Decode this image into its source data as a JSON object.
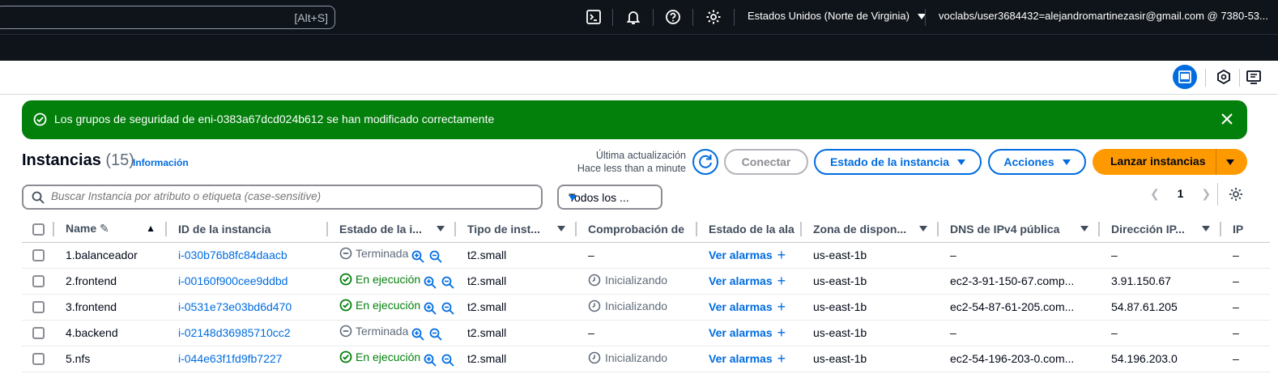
{
  "topbar": {
    "search_shortcut": "[Alt+S]",
    "region": "Estados Unidos (Norte de Virginia)",
    "account": "voclabs/user3684432=alejandromartinezasir@gmail.com @ 7380-53..."
  },
  "flash": {
    "message": "Los grupos de seguridad de eni-0383a67dcd024b612 se han modificado correctamente"
  },
  "header": {
    "title": "Instancias",
    "count": "(15)",
    "info": "Información",
    "last_update_label": "Última actualización",
    "last_update_value": "Hace less than a minute",
    "connect": "Conectar",
    "instance_state": "Estado de la instancia",
    "actions": "Acciones",
    "launch": "Lanzar instancias"
  },
  "filter": {
    "placeholder": "Buscar Instancia por atributo o etiqueta (case-sensitive)",
    "select_value": "Todos los ...",
    "page": "1"
  },
  "columns": [
    "Name",
    "ID de la instancia",
    "Estado de la i...",
    "Tipo de inst...",
    "Comprobación de",
    "Estado de la ala",
    "Zona de dispon...",
    "DNS de IPv4 pública",
    "Dirección IP...",
    "IP"
  ],
  "rows": [
    {
      "name": "1.balanceador",
      "id": "i-030b76b8fc84daacb",
      "state": "Terminada",
      "state_kind": "terminated",
      "type": "t2.small",
      "check": "–",
      "check_kind": "none",
      "alarm": "Ver alarmas",
      "zone": "us-east-1b",
      "dns": "–",
      "ip": "–",
      "ip2": "–"
    },
    {
      "name": "2.frontend",
      "id": "i-00160f900cee9ddbd",
      "state": "En ejecución",
      "state_kind": "running",
      "type": "t2.small",
      "check": "Inicializando",
      "check_kind": "init",
      "alarm": "Ver alarmas",
      "zone": "us-east-1b",
      "dns": "ec2-3-91-150-67.comp...",
      "ip": "3.91.150.67",
      "ip2": "–"
    },
    {
      "name": "3.frontend",
      "id": "i-0531e73e03bd6d470",
      "state": "En ejecución",
      "state_kind": "running",
      "type": "t2.small",
      "check": "Inicializando",
      "check_kind": "init",
      "alarm": "Ver alarmas",
      "zone": "us-east-1b",
      "dns": "ec2-54-87-61-205.com...",
      "ip": "54.87.61.205",
      "ip2": "–"
    },
    {
      "name": "4.backend",
      "id": "i-02148d36985710cc2",
      "state": "Terminada",
      "state_kind": "terminated",
      "type": "t2.small",
      "check": "–",
      "check_kind": "none",
      "alarm": "Ver alarmas",
      "zone": "us-east-1b",
      "dns": "–",
      "ip": "–",
      "ip2": "–"
    },
    {
      "name": "5.nfs",
      "id": "i-044e63f1fd9fb7227",
      "state": "En ejecución",
      "state_kind": "running",
      "type": "t2.small",
      "check": "Inicializando",
      "check_kind": "init",
      "alarm": "Ver alarmas",
      "zone": "us-east-1b",
      "dns": "ec2-54-196-203-0.com...",
      "ip": "54.196.203.0",
      "ip2": "–"
    }
  ],
  "colors": {
    "running": "#037f0c",
    "link": "#006ce0",
    "primary": "#ff9900",
    "flash": "#037f0c"
  }
}
